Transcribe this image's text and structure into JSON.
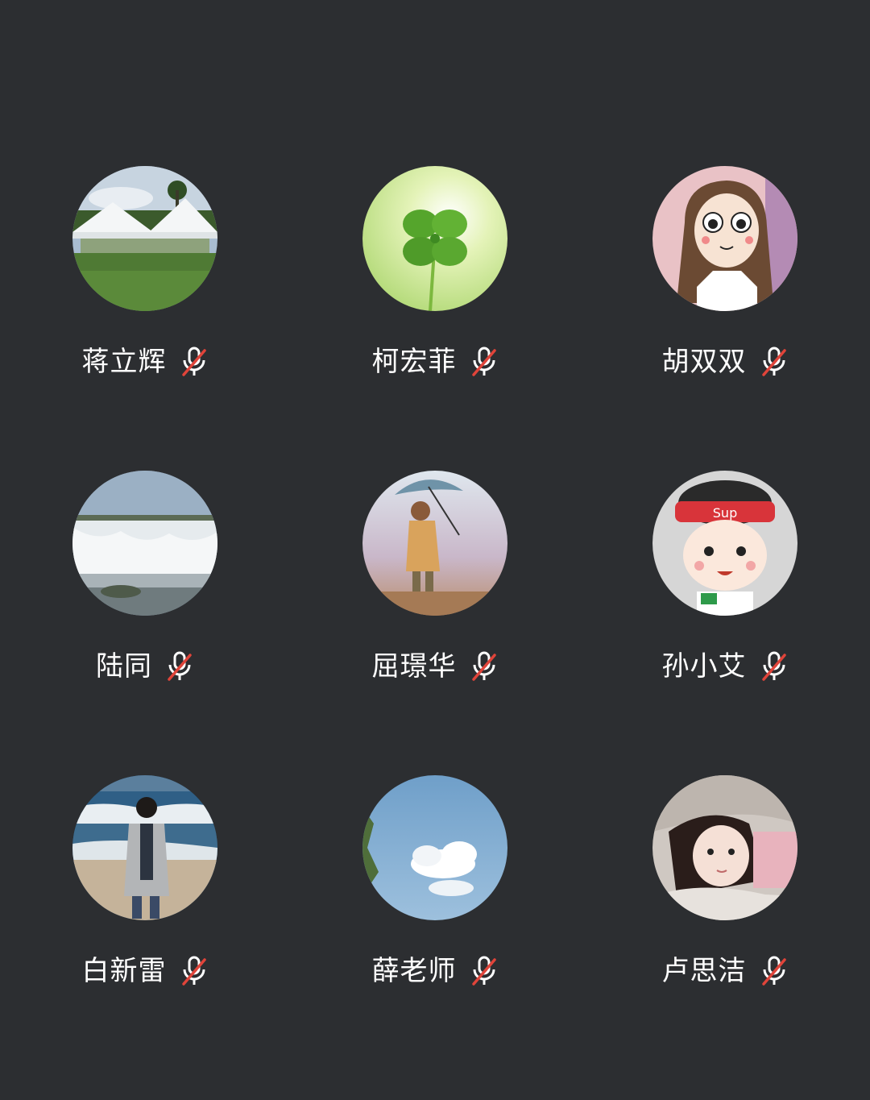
{
  "participants": [
    {
      "name": "蒋立辉",
      "avatar": "outdoor-tents-photo",
      "mic": "mic-muted-icon"
    },
    {
      "name": "柯宏菲",
      "avatar": "four-leaf-clover-photo",
      "mic": "mic-muted-icon"
    },
    {
      "name": "胡双双",
      "avatar": "cartoon-girl-illustration",
      "mic": "mic-muted-icon"
    },
    {
      "name": "陆同",
      "avatar": "waterfall-photo",
      "mic": "mic-muted-icon"
    },
    {
      "name": "屈璟华",
      "avatar": "child-with-umbrella-illustration",
      "mic": "mic-muted-icon"
    },
    {
      "name": "孙小艾",
      "avatar": "cartoon-boy-headband-illustration",
      "mic": "mic-muted-icon"
    },
    {
      "name": "白新雷",
      "avatar": "woman-on-beach-photo",
      "mic": "mic-muted-icon"
    },
    {
      "name": "薛老师",
      "avatar": "sky-clouds-photo",
      "mic": "mic-muted-icon"
    },
    {
      "name": "卢思洁",
      "avatar": "girl-portrait-photo",
      "mic": "mic-muted-icon"
    }
  ],
  "colors": {
    "background": "#2c2e31",
    "name_text": "#ffffff",
    "mic_muted_slash": "#e0443a"
  }
}
